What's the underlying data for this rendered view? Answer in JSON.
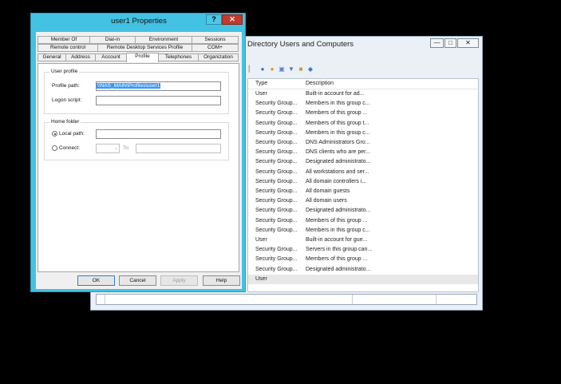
{
  "dialog": {
    "title": "user1 Properties",
    "help_glyph": "?",
    "close_glyph": "✕",
    "tabs_row1": [
      "Member Of",
      "Dial-in",
      "Environment",
      "Sessions"
    ],
    "tabs_row2": [
      "Remote control",
      "Remote Desktop Services Profile",
      "COM+"
    ],
    "tabs_row3": [
      "General",
      "Address",
      "Account",
      "Profile",
      "Telephones",
      "Organization"
    ],
    "active_tab": "Profile",
    "user_profile": {
      "group_label": "User profile",
      "profile_path_label": "Profile path:",
      "profile_path_value": "\\\\NAS_MAIN\\Profiles\\user1",
      "logon_script_label": "Logon script:",
      "logon_script_value": ""
    },
    "home_folder": {
      "group_label": "Home folder",
      "local_path_label": "Local path:",
      "local_path_value": "",
      "connect_label": "Connect:",
      "drive_value": "",
      "to_label": "To:",
      "to_value": ""
    },
    "buttons": {
      "ok": "OK",
      "cancel": "Cancel",
      "apply": "Apply",
      "help": "Help"
    }
  },
  "ad_window": {
    "title": "Directory Users and Computers",
    "minimize_glyph": "—",
    "maximize_glyph": "□",
    "close_glyph": "✕",
    "columns": [
      "Type",
      "Description"
    ],
    "rows": [
      {
        "type": "User",
        "description": "Built-in account for ad..."
      },
      {
        "type": "Security Group...",
        "description": "Members in this group c..."
      },
      {
        "type": "Security Group...",
        "description": "Members of this group ..."
      },
      {
        "type": "Security Group...",
        "description": "Members of this group t..."
      },
      {
        "type": "Security Group...",
        "description": "Members in this group c..."
      },
      {
        "type": "Security Group...",
        "description": "DNS Administrators Gro..."
      },
      {
        "type": "Security Group...",
        "description": "DNS clients who are per..."
      },
      {
        "type": "Security Group...",
        "description": "Designated administrato..."
      },
      {
        "type": "Security Group...",
        "description": "All workstations and ser..."
      },
      {
        "type": "Security Group...",
        "description": "All domain controllers i..."
      },
      {
        "type": "Security Group...",
        "description": "All domain guests"
      },
      {
        "type": "Security Group...",
        "description": "All domain users"
      },
      {
        "type": "Security Group...",
        "description": "Designated administrato..."
      },
      {
        "type": "Security Group...",
        "description": "Members of this group ..."
      },
      {
        "type": "Security Group...",
        "description": "Members in this group c..."
      },
      {
        "type": "User",
        "description": "Built-in account for gue..."
      },
      {
        "type": "Security Group...",
        "description": "Servers in this group can..."
      },
      {
        "type": "Security Group...",
        "description": "Members of this group ..."
      },
      {
        "type": "Security Group...",
        "description": "Designated administrato..."
      },
      {
        "type": "User",
        "description": ""
      }
    ]
  },
  "colors": {
    "dialog_frame": "#43c2e3",
    "close_button": "#c7392b",
    "selection": "#3399ff"
  }
}
